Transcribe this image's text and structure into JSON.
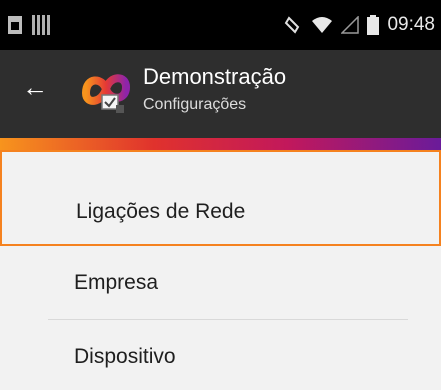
{
  "statusbar": {
    "time": "09:48",
    "icons": [
      "sim-icon",
      "qr-icon",
      "rotate-icon",
      "wifi-icon",
      "signal-icon",
      "battery-icon"
    ]
  },
  "appbar": {
    "title": "Demonstração",
    "subtitle": "Configurações",
    "back_icon": "arrow-left-icon",
    "logo": "app-logo"
  },
  "colors": {
    "accent": "#f5821f",
    "appbar_bg": "#2e2e2e",
    "statusbar_bg": "#000000",
    "background": "#f2f2f2"
  },
  "menu": {
    "selected_index": 0,
    "items": [
      {
        "label": "Ligações de Rede"
      },
      {
        "label": "Empresa"
      },
      {
        "label": "Dispositivo"
      }
    ]
  }
}
